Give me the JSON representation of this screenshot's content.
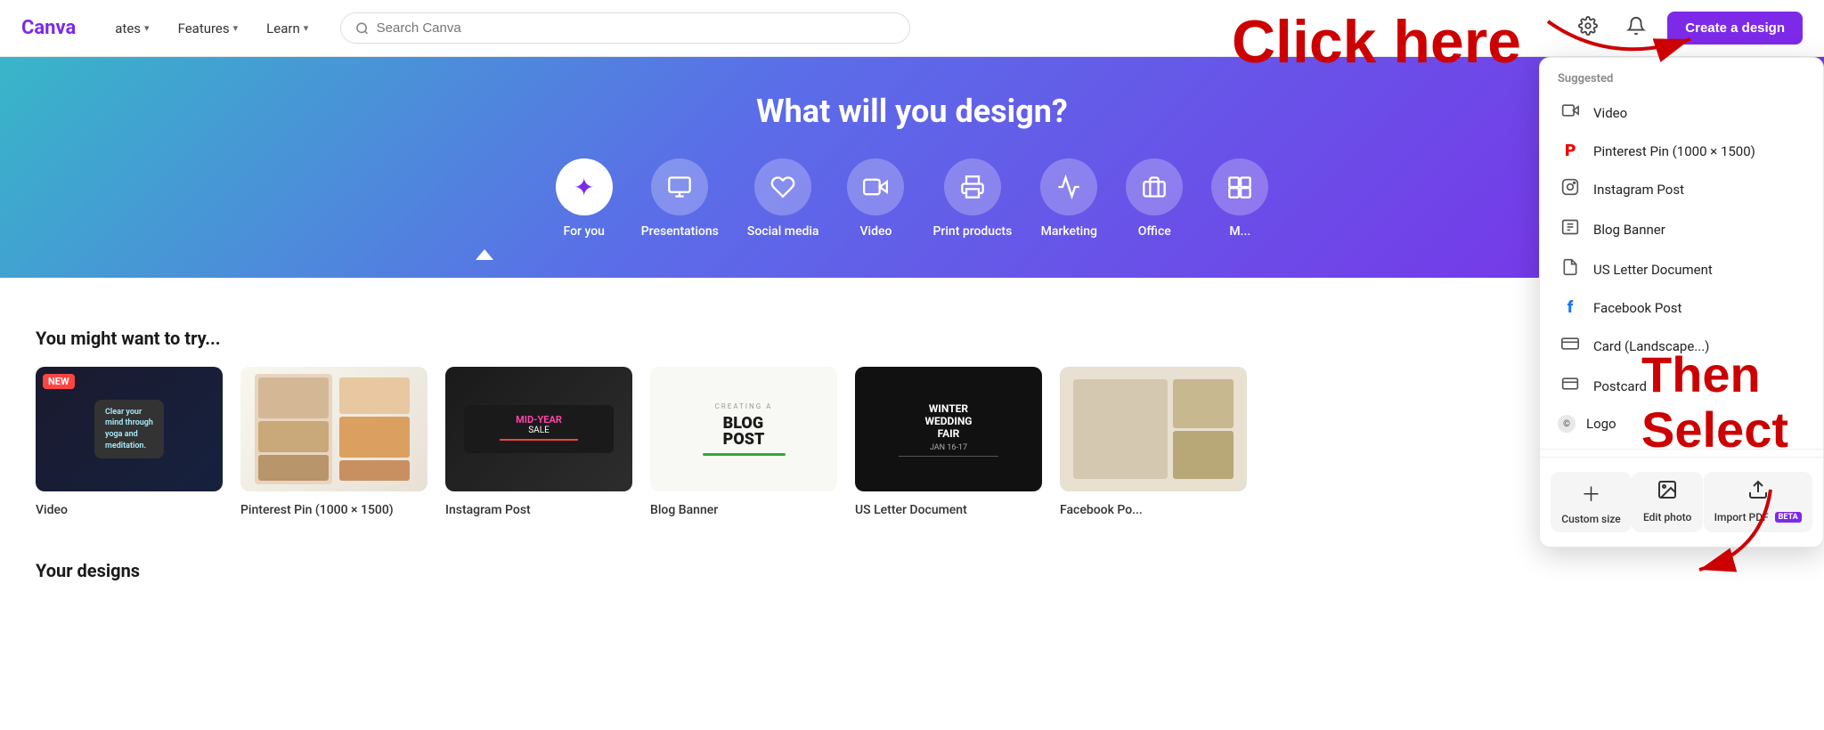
{
  "header": {
    "logo": "Canva",
    "nav": [
      {
        "label": "ates",
        "arrow": true
      },
      {
        "label": "Features",
        "arrow": true
      },
      {
        "label": "Learn",
        "arrow": true
      }
    ],
    "search_placeholder": "Search Canva",
    "create_button_label": "Create a design"
  },
  "hero": {
    "title": "What will you design?",
    "categories": [
      {
        "label": "For you",
        "icon": "✦",
        "active": true
      },
      {
        "label": "Presentations",
        "icon": "📁"
      },
      {
        "label": "Social media",
        "icon": "♥"
      },
      {
        "label": "Video",
        "icon": "🎬"
      },
      {
        "label": "Print products",
        "icon": "🖨"
      },
      {
        "label": "Marketing",
        "icon": "📢"
      },
      {
        "label": "Office",
        "icon": "💼"
      },
      {
        "label": "M...",
        "icon": "📦"
      }
    ]
  },
  "section": {
    "title": "You might want to try...",
    "cards": [
      {
        "label": "Video",
        "theme": "video",
        "badge": "NEW"
      },
      {
        "label": "Pinterest Pin (1000 × 1500)",
        "theme": "pinterest",
        "badge": null
      },
      {
        "label": "Instagram Post",
        "theme": "instagram",
        "badge": null
      },
      {
        "label": "Blog Banner",
        "theme": "blog",
        "badge": null
      },
      {
        "label": "US Letter Document",
        "theme": "us-letter",
        "badge": null
      },
      {
        "label": "Facebook Po...",
        "theme": "facebook",
        "badge": null
      }
    ]
  },
  "bottom_section": {
    "label": "Your designs"
  },
  "dropdown": {
    "section_label": "Suggested",
    "items": [
      {
        "label": "Video",
        "icon": "video"
      },
      {
        "label": "Pinterest Pin (1000 × 1500)",
        "icon": "pinterest"
      },
      {
        "label": "Instagram Post",
        "icon": "instagram"
      },
      {
        "label": "Blog Banner",
        "icon": "blog"
      },
      {
        "label": "US Letter Document",
        "icon": "doc"
      },
      {
        "label": "Facebook Post",
        "icon": "facebook"
      },
      {
        "label": "Card (Landscape...)",
        "icon": "card"
      },
      {
        "label": "Postcard",
        "icon": "postcard"
      },
      {
        "label": "Logo",
        "icon": "logo"
      }
    ],
    "actions": [
      {
        "label": "Custom size",
        "icon": "plus"
      },
      {
        "label": "Edit photo",
        "icon": "photo"
      },
      {
        "label": "Import PDF",
        "icon": "pdf",
        "beta": true
      }
    ]
  },
  "overlay": {
    "click_here_text": "Click here",
    "then_select_text": "Then\nSelect"
  }
}
